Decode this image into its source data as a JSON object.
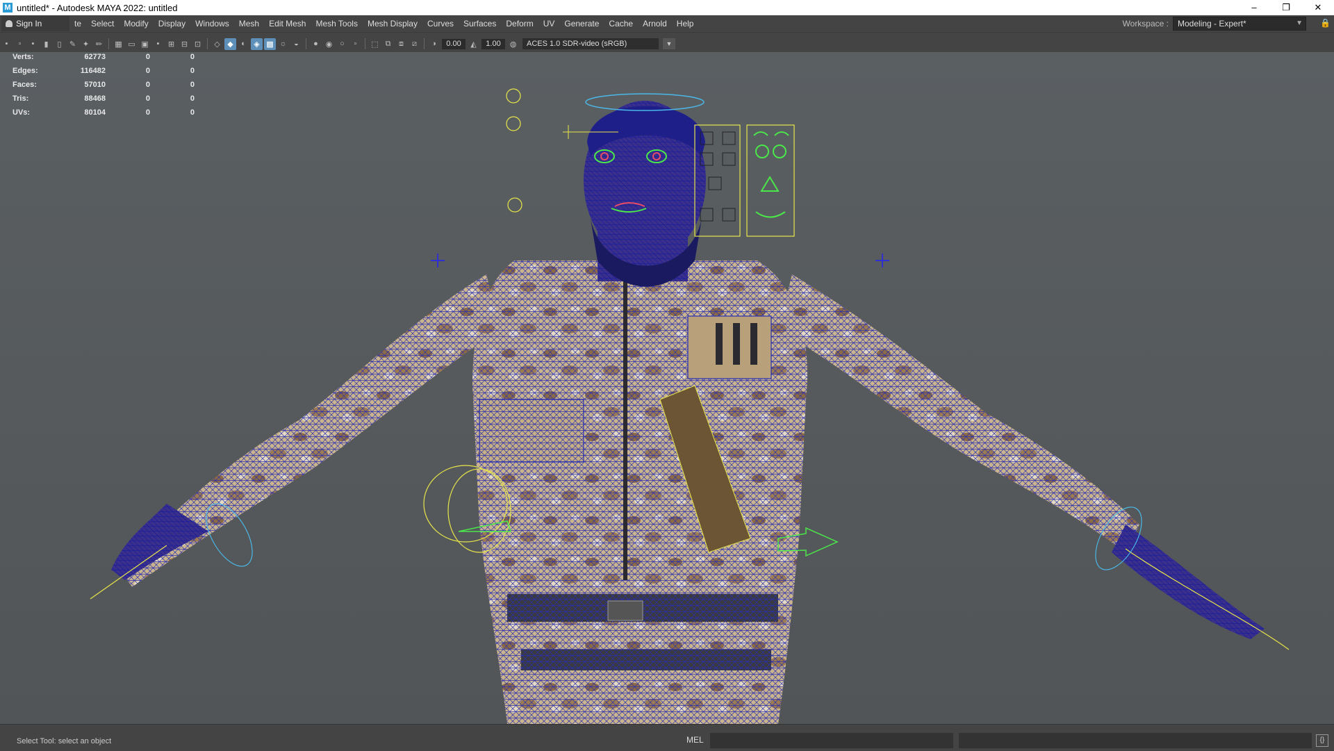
{
  "window": {
    "title": "untitled* - Autodesk MAYA 2022: untitled",
    "app_icon": "M",
    "minimize": "–",
    "maximize": "❐",
    "close": "✕"
  },
  "menubar": {
    "sign_in": "Sign In",
    "items": [
      "te",
      "Select",
      "Modify",
      "Display",
      "Windows",
      "Mesh",
      "Edit Mesh",
      "Mesh Tools",
      "Mesh Display",
      "Curves",
      "Surfaces",
      "Deform",
      "UV",
      "Generate",
      "Cache",
      "Arnold",
      "Help"
    ],
    "workspace_label": "Workspace :",
    "workspace_value": "Modeling - Expert*"
  },
  "panel_toolbar": {
    "exposure": "0.00",
    "gamma": "1.00",
    "color_space": "ACES 1.0 SDR-video (sRGB)"
  },
  "hud": {
    "rows": [
      {
        "label": "Verts:",
        "v1": "62773",
        "v2": "0",
        "v3": "0"
      },
      {
        "label": "Edges:",
        "v1": "116482",
        "v2": "0",
        "v3": "0"
      },
      {
        "label": "Faces:",
        "v1": "57010",
        "v2": "0",
        "v3": "0"
      },
      {
        "label": "Tris:",
        "v1": "88468",
        "v2": "0",
        "v3": "0"
      },
      {
        "label": "UVs:",
        "v1": "80104",
        "v2": "0",
        "v3": "0"
      }
    ]
  },
  "status": {
    "help_line": "Select Tool: select an object",
    "command_language": "MEL"
  },
  "colors": {
    "wire_blue": "#2a2fb0",
    "control_yellow": "#e8e64a",
    "control_cyan": "#4ab8e8",
    "control_green": "#4ae84a",
    "camo_base": "#c9b48e",
    "camo_dark": "#8b6a45"
  }
}
